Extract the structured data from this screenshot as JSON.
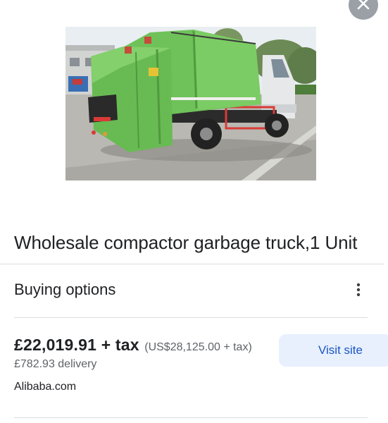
{
  "icons": {
    "close": "close-icon",
    "more": "more-vert-icon"
  },
  "product": {
    "image_alt": "green compactor garbage truck",
    "title": "Wholesale compactor garbage truck,1 Unit"
  },
  "buying_options": {
    "heading": "Buying options",
    "offers": [
      {
        "price": "£22,019.91 + tax",
        "usd_price": "(US$28,125.00 + tax)",
        "delivery": "£782.93 delivery",
        "seller": "Alibaba.com",
        "action_label": "Visit site"
      }
    ]
  },
  "colors": {
    "truck_body": "#6fc25a",
    "button_bg": "#e8f0fe",
    "button_text": "#1a56c4",
    "close_bg": "#9aa0a6"
  }
}
